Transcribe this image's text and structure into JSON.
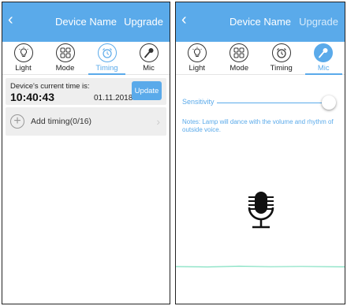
{
  "left": {
    "header": {
      "back": "‹",
      "title": "Device Name",
      "upgrade": "Upgrade"
    },
    "tabs": [
      {
        "label": "Light",
        "icon": "bulb-icon"
      },
      {
        "label": "Mode",
        "icon": "mode-grid-icon"
      },
      {
        "label": "Timing",
        "icon": "alarm-clock-icon",
        "active": true
      },
      {
        "label": "Mic",
        "icon": "microphone-icon"
      }
    ],
    "time_card": {
      "label": "Device's current time is:",
      "time": "10:40:43",
      "date": "01.11.2018",
      "update_label": "Update"
    },
    "add_timing": {
      "plus": "+",
      "label": "Add timing(0/16)",
      "chevron": "›"
    }
  },
  "right": {
    "header": {
      "back": "‹",
      "title": "Device Name",
      "upgrade": "Upgrade"
    },
    "tabs": [
      {
        "label": "Light",
        "icon": "bulb-icon"
      },
      {
        "label": "Mode",
        "icon": "mode-grid-icon"
      },
      {
        "label": "Timing",
        "icon": "alarm-clock-icon"
      },
      {
        "label": "Mic",
        "icon": "microphone-icon",
        "active": true
      }
    ],
    "sensitivity": {
      "label": "Sensitivity",
      "value": 1.0
    },
    "notes": "Notes: Lamp will dance with the volume and rhythm of outside voice."
  },
  "colors": {
    "accent": "#5aaaea",
    "card_bg": "#eeeeee",
    "wave": "#7fe0c0"
  }
}
